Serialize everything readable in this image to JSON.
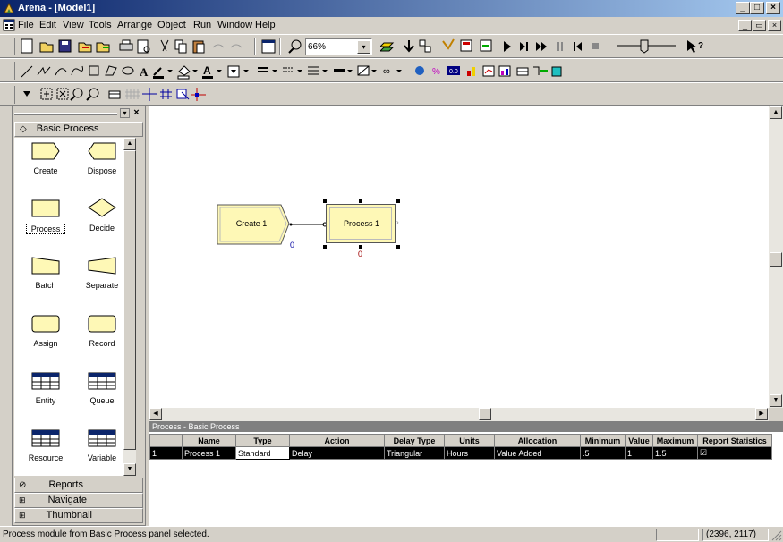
{
  "window": {
    "title": "Arena - [Model1]",
    "min": "_",
    "max": "□",
    "close": "×"
  },
  "menu": [
    "File",
    "Edit",
    "View",
    "Tools",
    "Arrange",
    "Object",
    "Run",
    "Window",
    "Help"
  ],
  "mdi": {
    "min": "_",
    "restore": "▭",
    "close": "×"
  },
  "toolbar": {
    "zoom_value": "66%",
    "dropdown": "▾"
  },
  "project_bar": {
    "panel_title": "Basic Process",
    "modules": [
      {
        "label": "Create"
      },
      {
        "label": "Dispose"
      },
      {
        "label": "Process"
      },
      {
        "label": "Decide"
      },
      {
        "label": "Batch"
      },
      {
        "label": "Separate"
      },
      {
        "label": "Assign"
      },
      {
        "label": "Record"
      },
      {
        "label": "Entity"
      },
      {
        "label": "Queue"
      },
      {
        "label": "Resource"
      },
      {
        "label": "Variable"
      }
    ],
    "bottom_panels": [
      "Reports",
      "Navigate",
      "Thumbnail"
    ]
  },
  "canvas": {
    "create_label": "Create 1",
    "create_count": "0",
    "process_label": "Process 1",
    "process_count": "0"
  },
  "spreadsheet": {
    "title": "Process - Basic Process",
    "columns": [
      "",
      "Name",
      "Type",
      "Action",
      "Delay Type",
      "Units",
      "Allocation",
      "Minimum",
      "Value",
      "Maximum",
      "Report Statistics"
    ],
    "row": {
      "num": "1",
      "name": "Process 1",
      "type": "Standard",
      "action": "Delay",
      "delay_type": "Triangular",
      "units": "Hours",
      "allocation": "Value Added",
      "minimum": ".5",
      "value": "1",
      "maximum": "1.5",
      "report_stats": "☑"
    }
  },
  "status": {
    "message": "Process module from Basic Process panel selected.",
    "coords": "(2396, 2117)"
  }
}
